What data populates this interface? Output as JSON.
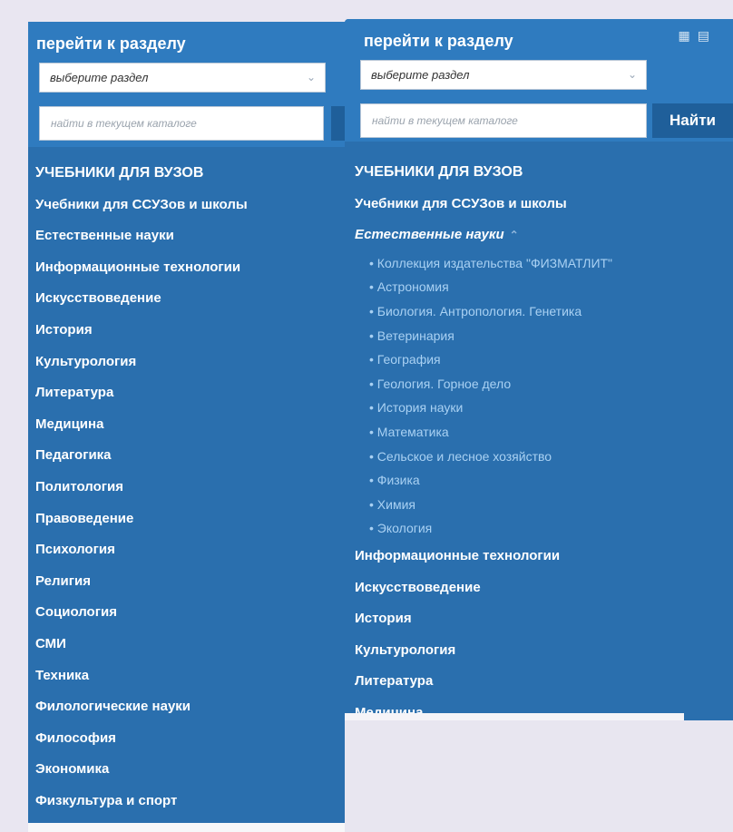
{
  "left": {
    "title": "перейти к разделу",
    "select_value": "выберите раздел",
    "search_placeholder": "найти в текущем каталоге",
    "items": [
      "УЧЕБНИКИ ДЛЯ ВУЗОВ",
      "Учебники для ССУЗов и школы",
      "Естественные науки",
      "Информационные технологии",
      "Искусствоведение",
      "История",
      "Культурология",
      "Литература",
      "Медицина",
      "Педагогика",
      "Политология",
      "Правоведение",
      "Психология",
      "Религия",
      "Социология",
      "СМИ",
      "Техника",
      "Филологические науки",
      "Философия",
      "Экономика",
      "Физкультура и спорт"
    ]
  },
  "right": {
    "title": "перейти к разделу",
    "select_value": "выберите раздел",
    "search_placeholder": "найти в текущем каталоге",
    "find_button": "Найти",
    "top_items": [
      "УЧЕБНИКИ ДЛЯ ВУЗОВ",
      "Учебники для ССУЗов и школы"
    ],
    "active_item": "Естественные науки",
    "sub_items": [
      "Коллекция издательства \"ФИЗМАТЛИТ\"",
      "Астрономия",
      "Биология. Антропология. Генетика",
      "Ветеринария",
      "География",
      "Геология. Горное дело",
      "История науки",
      "Математика",
      "Сельское и лесное хозяйство",
      "Физика",
      "Химия",
      "Экология"
    ],
    "bottom_items": [
      "Информационные технологии",
      "Искусствоведение",
      "История",
      "Культурология",
      "Литература",
      "Медицина"
    ]
  },
  "colors": {
    "panel": "#2a6fae",
    "header": "#2f7bbf",
    "sub_item_text": "#a9d1f3",
    "button": "#1f5f9a"
  },
  "icons": {
    "select": "chevron-down-icon",
    "active": "chevron-up-icon",
    "tree": [
      "tree-expand-icon",
      "tree-collapse-icon"
    ]
  }
}
